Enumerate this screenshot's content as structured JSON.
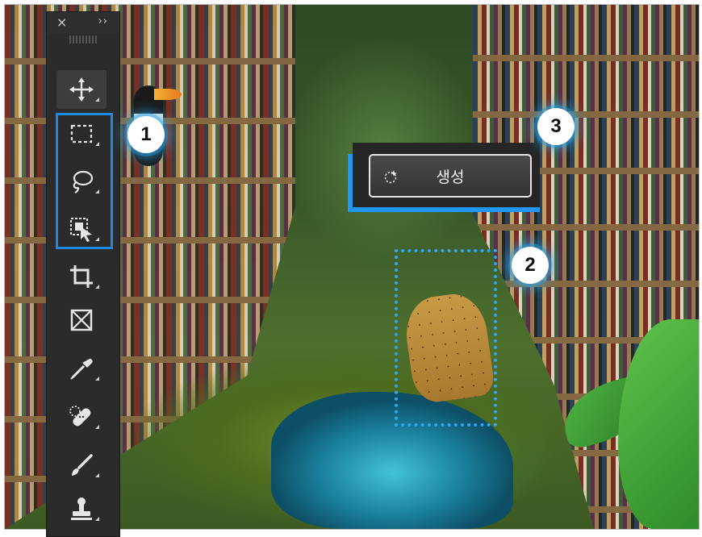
{
  "toolbar": {
    "close_icon": "×",
    "expand_icon": "››",
    "tools": [
      {
        "name": "move-tool",
        "icon": "move-icon"
      },
      {
        "name": "rectangular-marquee-tool",
        "icon": "rectangular-marquee-icon"
      },
      {
        "name": "lasso-tool",
        "icon": "lasso-icon"
      },
      {
        "name": "object-selection-tool",
        "icon": "object-selection-icon"
      },
      {
        "name": "crop-tool",
        "icon": "crop-icon"
      },
      {
        "name": "frame-tool",
        "icon": "frame-icon"
      },
      {
        "name": "eyedropper-tool",
        "icon": "eyedropper-icon"
      },
      {
        "name": "spot-healing-tool",
        "icon": "bandage-icon"
      },
      {
        "name": "brush-tool",
        "icon": "brush-icon"
      },
      {
        "name": "clone-stamp-tool",
        "icon": "stamp-icon"
      }
    ]
  },
  "callouts": {
    "one": "1",
    "two": "2",
    "three": "3"
  },
  "contextual_taskbar": {
    "generate_label": "생성"
  },
  "colors": {
    "highlight_blue": "#1e88e5",
    "selection_blue": "#2fa6f0",
    "toolbar_bg": "#2b2b2b"
  }
}
